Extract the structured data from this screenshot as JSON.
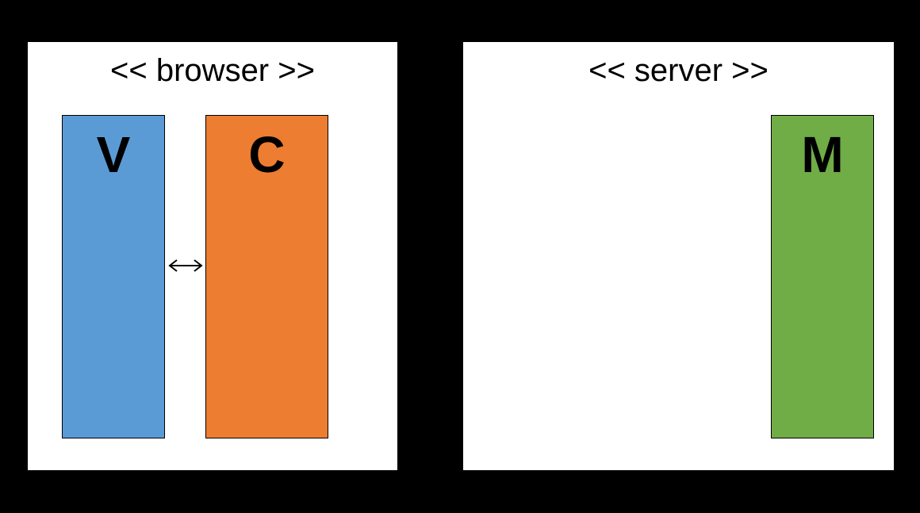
{
  "panels": {
    "left": {
      "title": "<< browser >>"
    },
    "right": {
      "title": "<< server >>"
    }
  },
  "blocks": {
    "v": {
      "label": "V",
      "color": "#5b9bd5"
    },
    "c": {
      "label": "C",
      "color": "#ed7d31"
    },
    "m": {
      "label": "M",
      "color": "#70ad47"
    }
  }
}
